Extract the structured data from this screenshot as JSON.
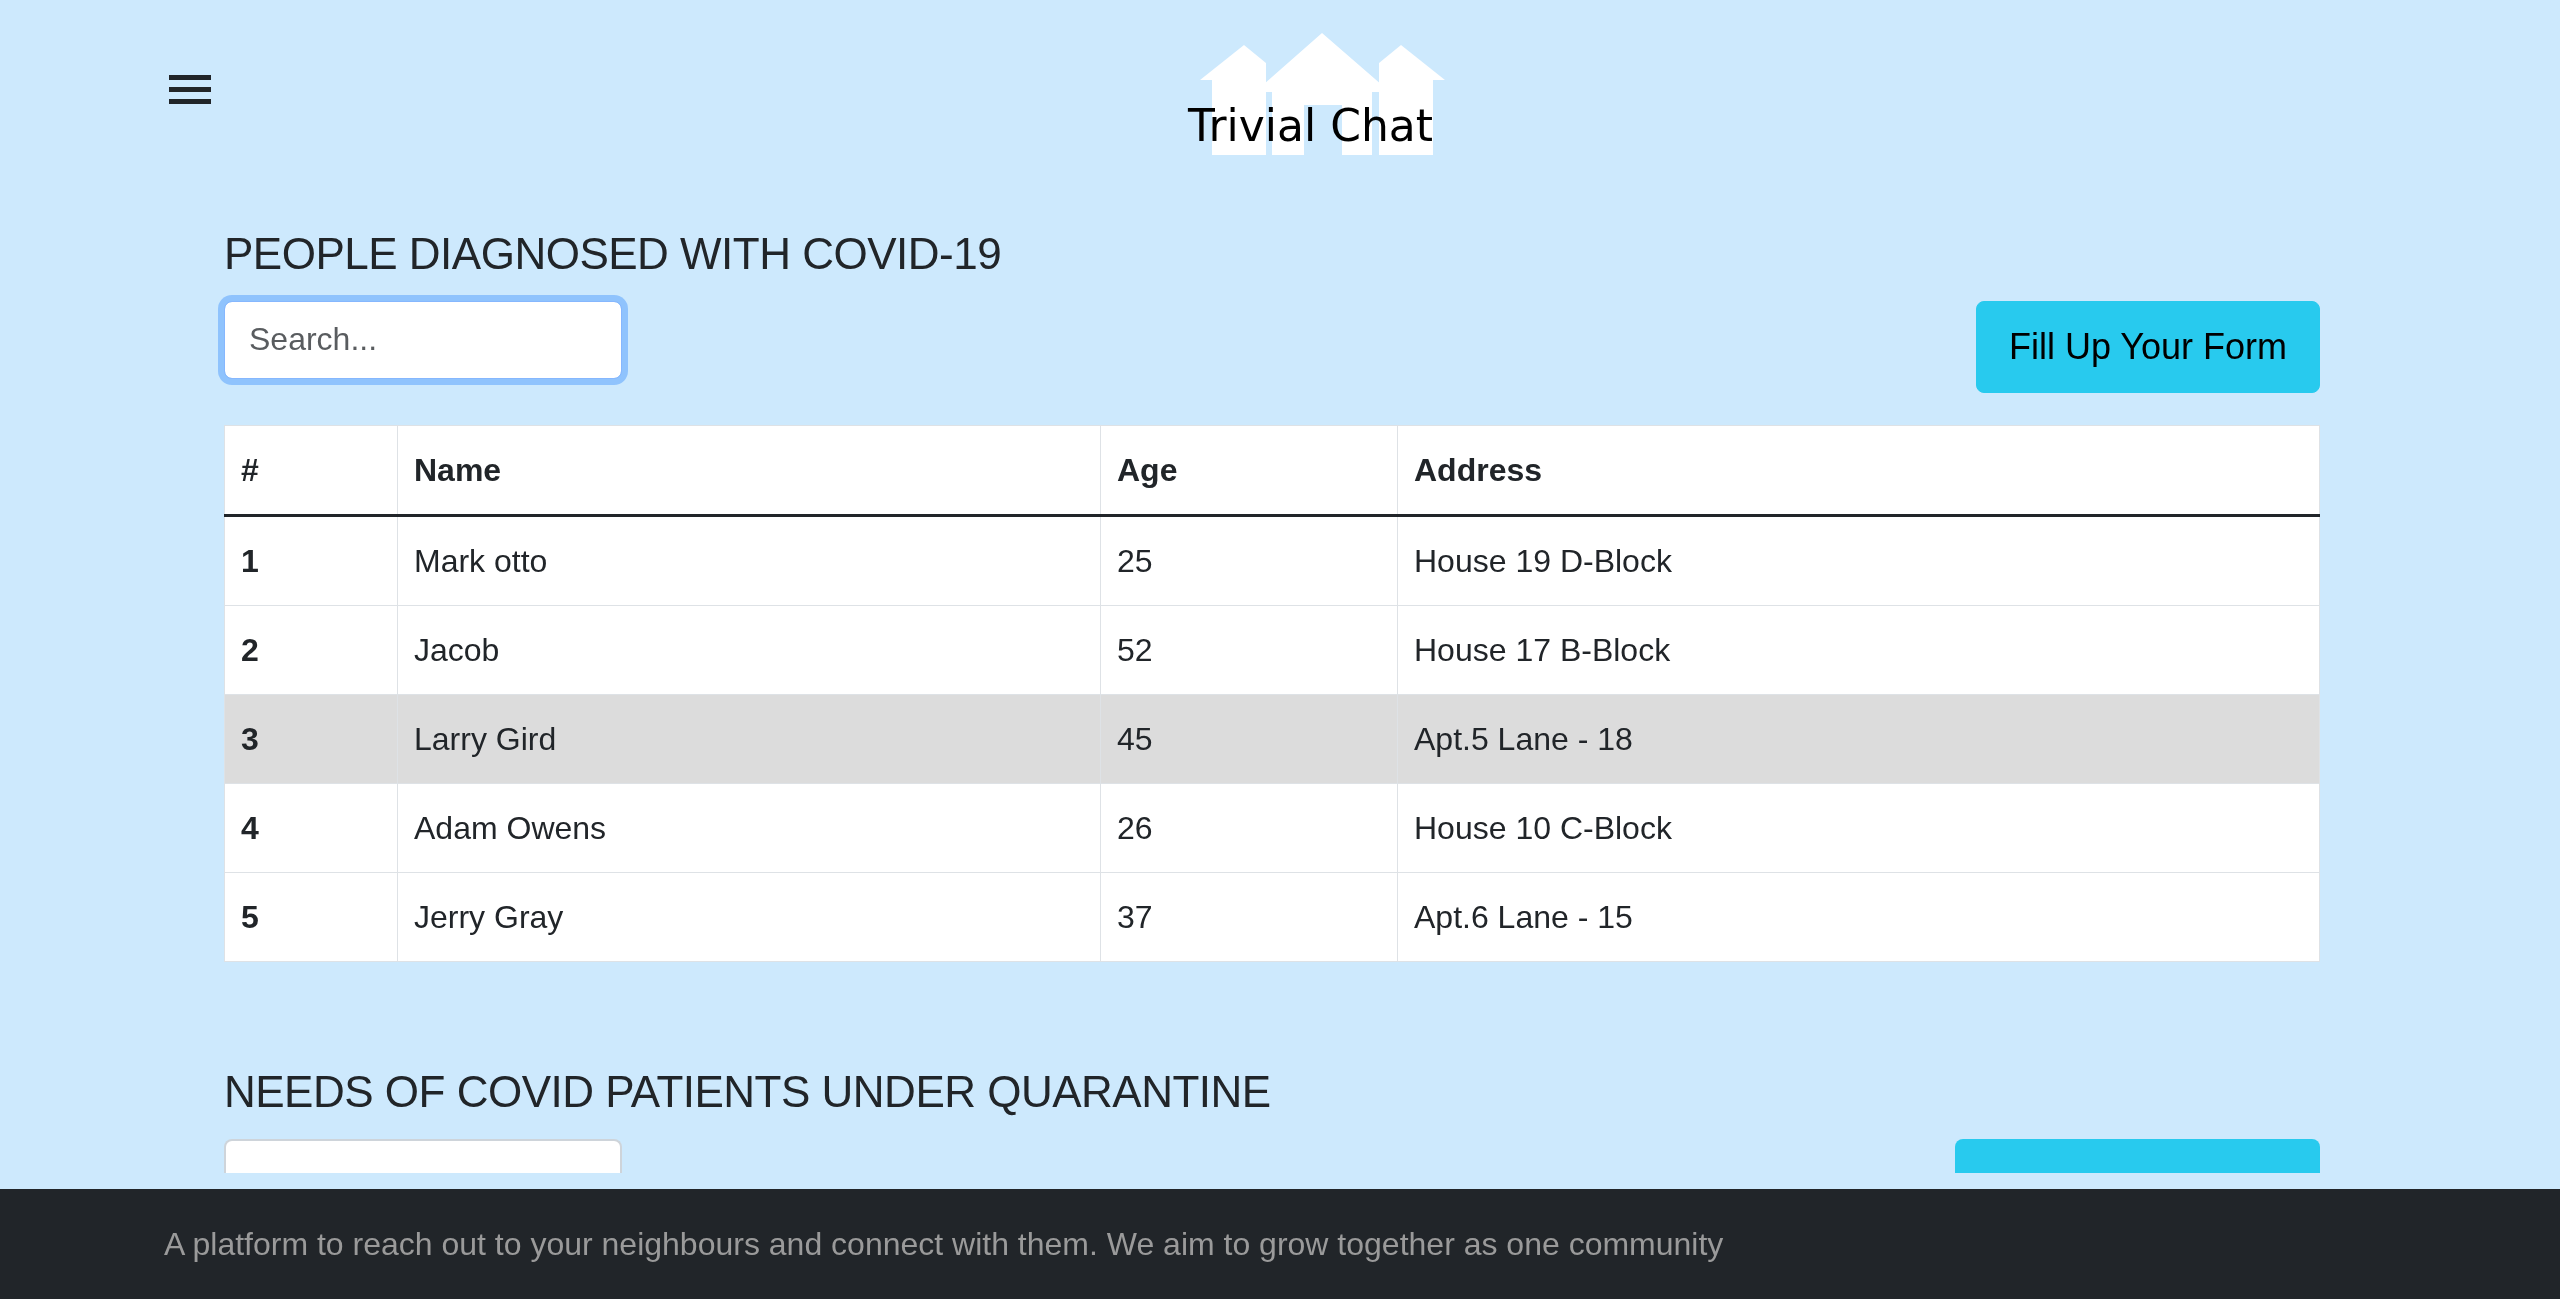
{
  "header": {
    "logo_text": "Trivial Chat"
  },
  "sections": [
    {
      "title": "PEOPLE DIAGNOSED WITH COVID-19",
      "kind": "full",
      "search": {
        "placeholder": "Search...",
        "focused": true
      },
      "button": "Fill Up Your Form",
      "table": {
        "columns": [
          "#",
          "Name",
          "Age",
          "Address"
        ],
        "rows": [
          {
            "cells": [
              "1",
              "Mark otto",
              "25",
              "House 19 D-Block"
            ],
            "highlighted": false
          },
          {
            "cells": [
              "2",
              "Jacob",
              "52",
              "House 17 B-Block"
            ],
            "highlighted": false
          },
          {
            "cells": [
              "3",
              "Larry Gird",
              "45",
              "Apt.5 Lane - 18"
            ],
            "highlighted": true
          },
          {
            "cells": [
              "4",
              "Adam Owens",
              "26",
              "House 10 C-Block"
            ],
            "highlighted": false
          },
          {
            "cells": [
              "5",
              "Jerry Gray",
              "37",
              "Apt.6 Lane - 15"
            ],
            "highlighted": false
          }
        ]
      }
    },
    {
      "title": "NEEDS OF COVID PATIENTS UNDER QUARANTINE",
      "kind": "cut"
    }
  ],
  "footer": {
    "text": "A platform to reach out to your neighbours and connect with them. We aim to grow together as one community"
  }
}
